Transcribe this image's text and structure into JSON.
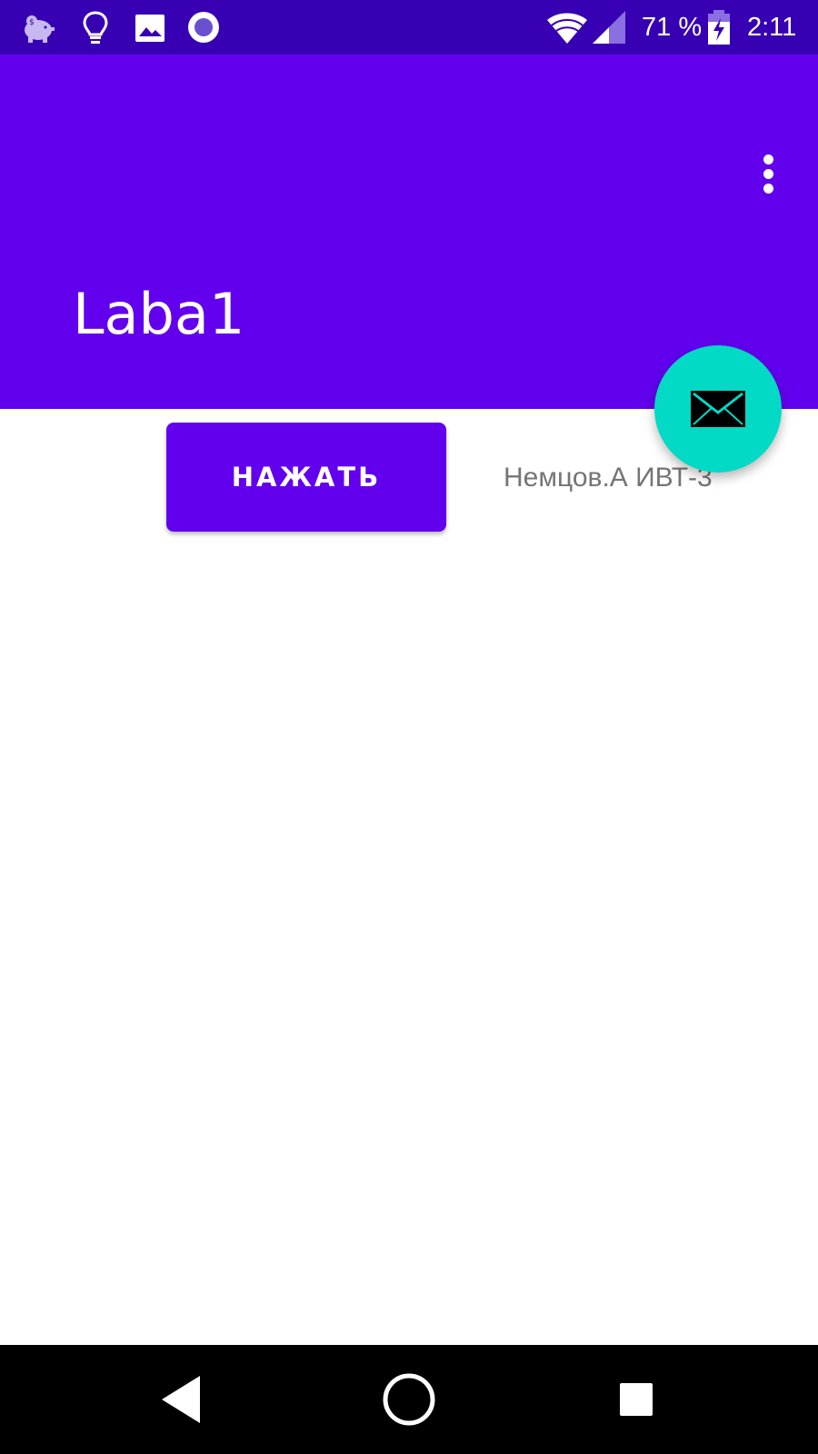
{
  "status_bar": {
    "battery_percent": "71 %",
    "time": "2:11",
    "icons": [
      "piggy-bank-icon",
      "lightbulb-icon",
      "image-icon",
      "record-icon",
      "wifi-icon",
      "signal-icon",
      "battery-charging-icon"
    ]
  },
  "app_bar": {
    "title": "Laba1",
    "menu_icon": "more-vert-icon"
  },
  "content": {
    "button_label": "НАЖАТЬ",
    "label": "Немцов.А ИВТ-3"
  },
  "fab": {
    "icon": "email-icon"
  },
  "nav_bar": {
    "icons": [
      "back-icon",
      "home-icon",
      "recents-icon"
    ]
  },
  "colors": {
    "status_bar": "#3700b3",
    "primary": "#6200ee",
    "accent": "#03dac5",
    "label_text": "#757575",
    "nav_bar": "#000000"
  }
}
